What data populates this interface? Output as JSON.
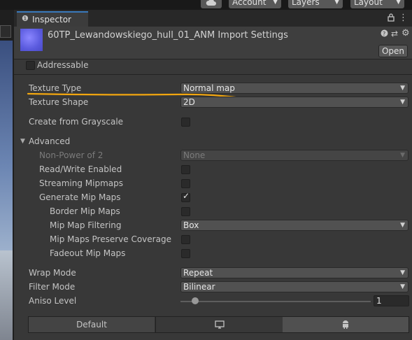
{
  "toolbar": {
    "account_label": "Account",
    "layers_label": "Layers",
    "layout_label": "Layout"
  },
  "tab": {
    "title": "Inspector"
  },
  "header": {
    "title": "60TP_Lewandowskiego_hull_01_ANM Import Settings",
    "open_label": "Open"
  },
  "addressable": {
    "label": "Addressable",
    "checked": false
  },
  "fields": {
    "texture_type": {
      "label": "Texture Type",
      "value": "Normal map"
    },
    "texture_shape": {
      "label": "Texture Shape",
      "value": "2D"
    },
    "create_from_grayscale": {
      "label": "Create from Grayscale",
      "checked": false
    },
    "advanced": {
      "label": "Advanced"
    },
    "non_power_of_2": {
      "label": "Non-Power of 2",
      "value": "None"
    },
    "read_write": {
      "label": "Read/Write Enabled",
      "checked": false
    },
    "streaming_mipmaps": {
      "label": "Streaming Mipmaps",
      "checked": false
    },
    "generate_mip_maps": {
      "label": "Generate Mip Maps",
      "checked": true
    },
    "border_mip_maps": {
      "label": "Border Mip Maps",
      "checked": false
    },
    "mip_map_filtering": {
      "label": "Mip Map Filtering",
      "value": "Box"
    },
    "mip_maps_preserve_coverage": {
      "label": "Mip Maps Preserve Coverage",
      "checked": false
    },
    "fadeout_mip_maps": {
      "label": "Fadeout Mip Maps",
      "checked": false
    },
    "wrap_mode": {
      "label": "Wrap Mode",
      "value": "Repeat"
    },
    "filter_mode": {
      "label": "Filter Mode",
      "value": "Bilinear"
    },
    "aniso_level": {
      "label": "Aniso Level",
      "value": "1"
    }
  },
  "platform_tabs": {
    "default_label": "Default",
    "standalone_icon": "monitor-icon",
    "android_icon": "android-icon"
  },
  "colors": {
    "annotation_underline": "#f2a60f",
    "tab_accent": "#3a79bb"
  }
}
